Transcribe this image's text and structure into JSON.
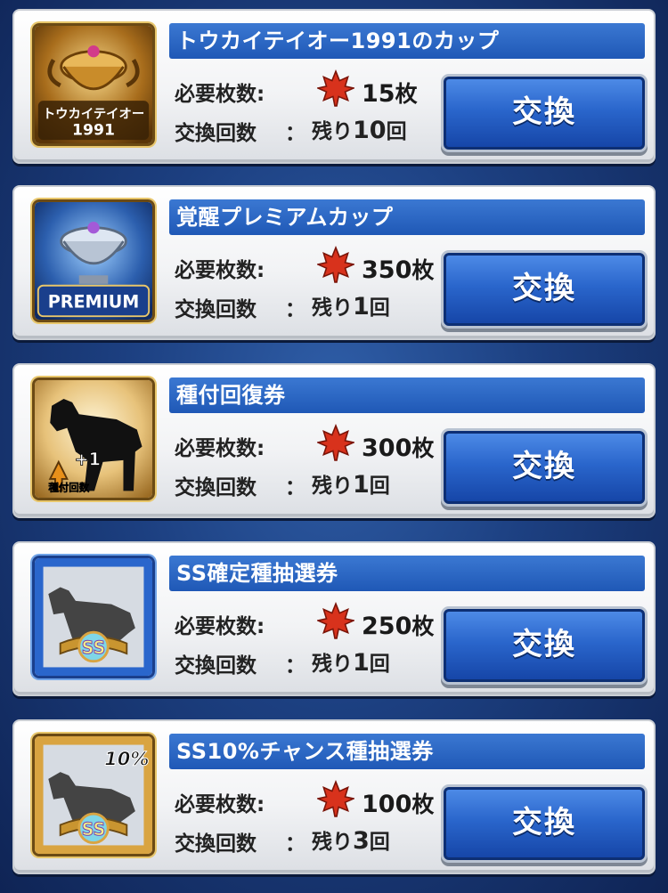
{
  "labels": {
    "required": "必要枚数:",
    "exchange_count": "交換回数",
    "colon": "：",
    "button": "交換"
  },
  "items": [
    {
      "title": "トウカイテイオー1991のカップ",
      "cost": "15",
      "cost_unit": "枚",
      "remain_prefix": "残り",
      "remain": "10",
      "remain_unit": "回",
      "icon": "trophy-gold-icon",
      "badge_line1": "トウカイテイオー",
      "badge_line2": "1991"
    },
    {
      "title": "覚醒プレミアムカップ",
      "cost": "350",
      "cost_unit": "枚",
      "remain_prefix": "残り",
      "remain": "1",
      "remain_unit": "回",
      "icon": "trophy-premium-icon",
      "badge_line1": "PREMIUM"
    },
    {
      "title": "種付回復券",
      "cost": "300",
      "cost_unit": "枚",
      "remain_prefix": "残り",
      "remain": "1",
      "remain_unit": "回",
      "icon": "horse-silhouette-icon",
      "badge_line1": "+1",
      "badge_line2": "種付回数"
    },
    {
      "title": "SS確定種抽選券",
      "cost": "250",
      "cost_unit": "枚",
      "remain_prefix": "残り",
      "remain": "1",
      "remain_unit": "回",
      "icon": "ss-ticket-icon",
      "badge_line1": "SS"
    },
    {
      "title": "SS10%チャンス種抽選券",
      "cost": "100",
      "cost_unit": "枚",
      "remain_prefix": "残り",
      "remain": "3",
      "remain_unit": "回",
      "icon": "ss-chance-ticket-icon",
      "badge_line1": "SS",
      "badge_line2": "10%"
    }
  ],
  "colors": {
    "title_bar": "#2a66cc",
    "button": "#1f5bc0",
    "leaf": "#d8321c",
    "gold": "#d9a441"
  }
}
